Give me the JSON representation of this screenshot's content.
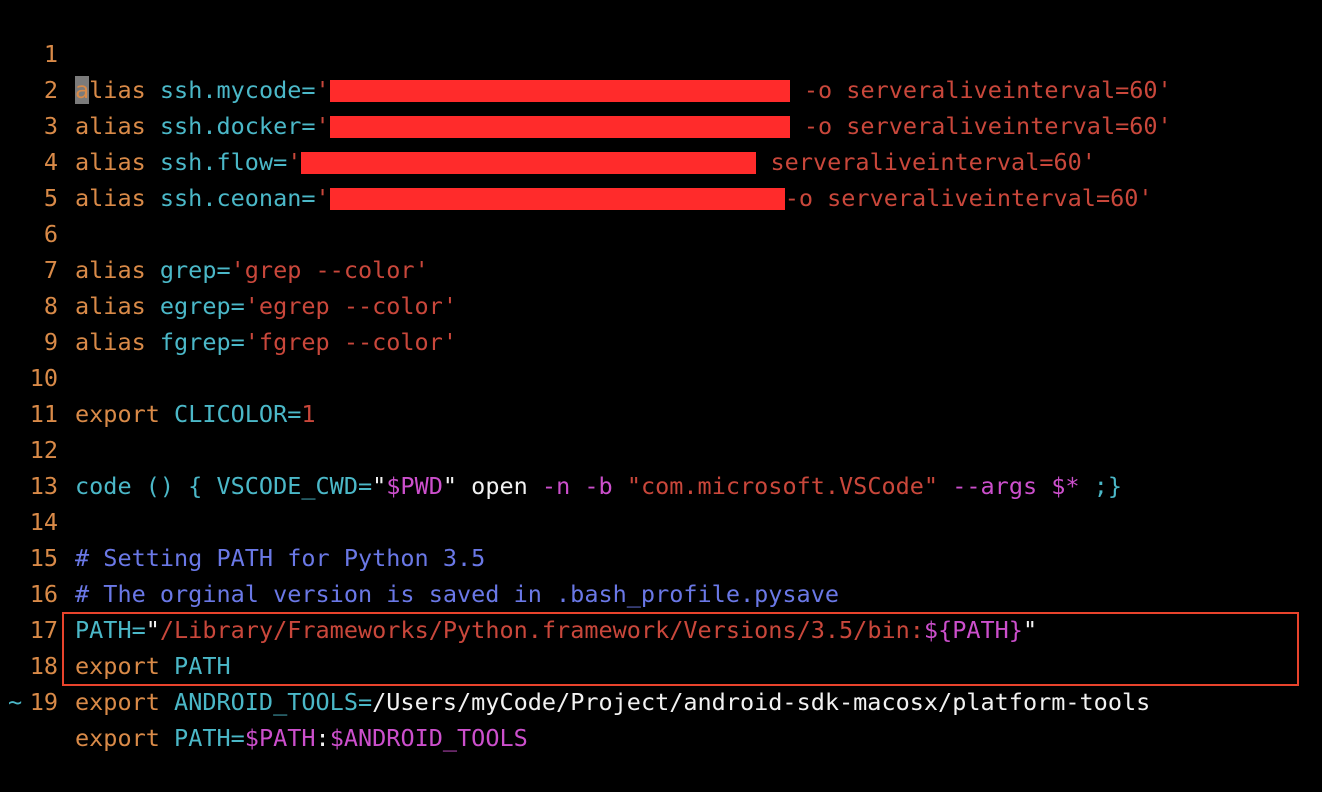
{
  "lines": [
    {
      "n": "1",
      "a": "a",
      "b": "lias ",
      "c": "ssh.mycode=",
      "d": "'",
      "e": " -o serveraliveinterval=60'"
    },
    {
      "n": "2",
      "a": "alias ",
      "c": "ssh.docker=",
      "d": "'",
      "e": " -o serveraliveinterval=60'"
    },
    {
      "n": "3",
      "a": "alias ",
      "c": "ssh.flow=",
      "d": "'",
      "e": " serveraliveinterval=60'"
    },
    {
      "n": "4",
      "a": "alias ",
      "c": "ssh.ceonan=",
      "d": "'",
      "e": "-o serveraliveinterval=60'"
    },
    {
      "n": "5"
    },
    {
      "n": "6",
      "a": "alias ",
      "c": "grep=",
      "d": "'grep --color'"
    },
    {
      "n": "7",
      "a": "alias ",
      "c": "egrep=",
      "d": "'egrep --color'"
    },
    {
      "n": "8",
      "a": "alias ",
      "c": "fgrep=",
      "d": "'fgrep --color'"
    },
    {
      "n": "9"
    },
    {
      "n": "10",
      "a": "export ",
      "c": "CLICOLOR=",
      "d": "1"
    },
    {
      "n": "11"
    },
    {
      "n": "12",
      "c": "code () { VSCODE_CWD=",
      "q1": "\"",
      "v1": "$PWD",
      "q2": "\"",
      "w": " open ",
      "f": "-n -b ",
      "s": "\"com.microsoft.VSCode\"",
      "f2": " --args ",
      "v2": "$*",
      "t": " ;}"
    },
    {
      "n": "13"
    },
    {
      "n": "14",
      "m": "# Setting PATH for Python 3.5"
    },
    {
      "n": "15",
      "m": "# The orginal version is saved in .bash_profile.pysave"
    },
    {
      "n": "16",
      "c": "PATH=",
      "q1": "\"",
      "s": "/Library/Frameworks/Python.framework/Versions/3.5/bin:",
      "v1": "${PATH}",
      "q2": "\""
    },
    {
      "n": "17",
      "a": "export ",
      "c": "PATH"
    },
    {
      "n": "18",
      "a": "export ",
      "c": "ANDROID_TOOLS=",
      "w": "/Users/myCode/Project/android-sdk-macosx/platform-tools"
    },
    {
      "n": "19",
      "a": "export ",
      "c": "PATH=",
      "v1": "$PATH",
      "w": ":",
      "v2": "$ANDROID_TOOLS"
    }
  ],
  "tilde": "~",
  "colors": {
    "keyword": "#d98a48",
    "identifier": "#4bb8c8",
    "string": "#c9473b",
    "variable": "#cc4fcc",
    "comment": "#6a78e6",
    "highlight_border": "#e8432c",
    "redaction": "#ff2b2b"
  }
}
